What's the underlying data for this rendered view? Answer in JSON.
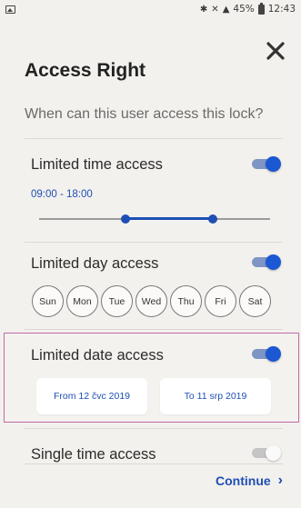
{
  "status_bar": {
    "bluetooth": "✱",
    "mute": "✕",
    "signal": "▲",
    "battery": "45%",
    "time": "12:43"
  },
  "header": {
    "title": "Access Right",
    "subtitle": "When can this user access this lock?"
  },
  "limited_time": {
    "label": "Limited time access",
    "enabled": true,
    "range_text": "09:00 - 18:00",
    "slider_start_hour": 9,
    "slider_end_hour": 18,
    "slider_min_hour": 0,
    "slider_max_hour": 24
  },
  "limited_day": {
    "label": "Limited day access",
    "enabled": true,
    "days": [
      "Sun",
      "Mon",
      "Tue",
      "Wed",
      "Thu",
      "Fri",
      "Sat"
    ]
  },
  "limited_date": {
    "label": "Limited date access",
    "enabled": true,
    "from_label": "From 12 čvc 2019",
    "to_label": "To 11 srp 2019"
  },
  "single_time": {
    "label": "Single time access",
    "enabled": false
  },
  "footer": {
    "continue_label": "Continue",
    "continue_icon": "›"
  },
  "colors": {
    "accent": "#1d4fb5",
    "toggle_on": "#1b58d2",
    "highlight_border": "#c06aa7",
    "background": "#f3f1ed"
  }
}
